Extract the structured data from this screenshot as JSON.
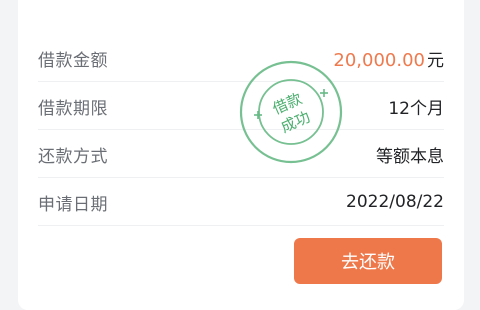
{
  "details": {
    "amount_label": "借款金额",
    "amount_value": "20,000.00",
    "amount_unit": "元",
    "term_label": "借款期限",
    "term_value": "12个月",
    "method_label": "还款方式",
    "method_value": "等额本息",
    "date_label": "申请日期",
    "date_value": "2022/08/22"
  },
  "stamp": {
    "line1": "借款",
    "line2": "成功",
    "color": "#4caf6f"
  },
  "actions": {
    "repay_label": "去还款"
  },
  "colors": {
    "accent": "#ef784b",
    "amount": "#ef7a4e"
  }
}
